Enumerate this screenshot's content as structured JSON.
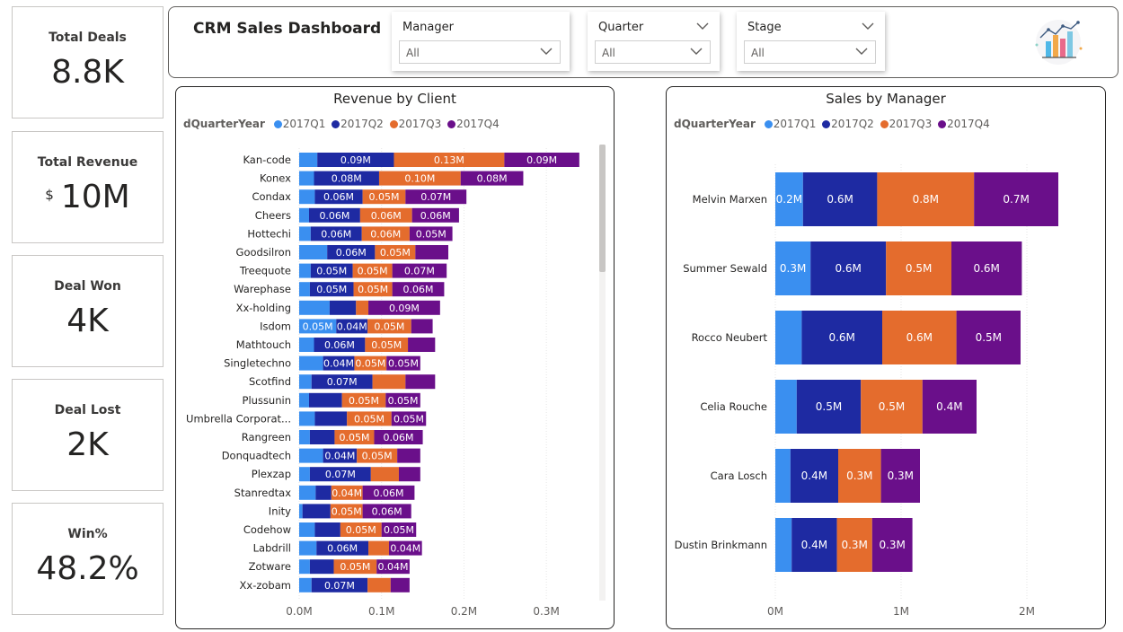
{
  "kpis": [
    {
      "label": "Total Deals",
      "value": "8.8K",
      "prefix": ""
    },
    {
      "label": "Total Revenue",
      "value": "10M",
      "prefix": "$"
    },
    {
      "label": "Deal Won",
      "value": "4K",
      "prefix": ""
    },
    {
      "label": "Deal Lost",
      "value": "2K",
      "prefix": ""
    },
    {
      "label": "Win%",
      "value": "48.2%",
      "prefix": ""
    }
  ],
  "header": {
    "title": "CRM Sales Dashboard",
    "logo_icon": "bar-line-chart-icon",
    "slicers": [
      {
        "label": "Manager",
        "value": "All",
        "header_chevron": false
      },
      {
        "label": "Quarter",
        "value": "All",
        "header_chevron": true
      },
      {
        "label": "Stage",
        "value": "All",
        "header_chevron": true
      }
    ]
  },
  "colors": {
    "2017Q1": "#3a8ff0",
    "2017Q2": "#1e2aa2",
    "2017Q3": "#e46c2d",
    "2017Q4": "#6a0f8a",
    "label_text": "#ffffff",
    "axis_text": "#605e5c"
  },
  "legend": {
    "title": "dQuarterYear",
    "items": [
      "2017Q1",
      "2017Q2",
      "2017Q3",
      "2017Q4"
    ]
  },
  "chart_data": [
    {
      "type": "bar",
      "orientation": "horizontal",
      "stacked": true,
      "title": "Revenue by Client",
      "legend_title": "dQuarterYear",
      "categories": [
        "Kan-code",
        "Konex",
        "Condax",
        "Cheers",
        "Hottechi",
        "Goodsilron",
        "Treequote",
        "Warephase",
        "Xx-holding",
        "Isdom",
        "Mathtouch",
        "Singletechno",
        "Scotfind",
        "Plussunin",
        "Umbrella Corporat...",
        "Rangreen",
        "Donquadtech",
        "Plexzap",
        "Stanredtax",
        "Inity",
        "Codehow",
        "Labdrill",
        "Zotware",
        "Xx-zobam"
      ],
      "series": [
        {
          "name": "2017Q1",
          "values": [
            0.022,
            0.018,
            0.019,
            0.012,
            0.014,
            0.034,
            0.014,
            0.013,
            0.037,
            0.045,
            0.018,
            0.029,
            0.015,
            0.012,
            0.019,
            0.013,
            0.029,
            0.013,
            0.02,
            0.004,
            0.019,
            0.021,
            0.013,
            0.015
          ]
        },
        {
          "name": "2017Q2",
          "values": [
            0.093,
            0.079,
            0.058,
            0.062,
            0.062,
            0.058,
            0.051,
            0.053,
            0.032,
            0.038,
            0.062,
            0.038,
            0.074,
            0.04,
            0.039,
            0.03,
            0.041,
            0.074,
            0.019,
            0.034,
            0.031,
            0.063,
            0.029,
            0.068
          ]
        },
        {
          "name": "2017Q3",
          "values": [
            0.134,
            0.099,
            0.052,
            0.063,
            0.058,
            0.049,
            0.048,
            0.047,
            0.015,
            0.053,
            0.052,
            0.039,
            0.04,
            0.053,
            0.054,
            0.048,
            0.049,
            0.034,
            0.038,
            0.039,
            0.05,
            0.025,
            0.052,
            0.028
          ]
        },
        {
          "name": "2017Q4",
          "values": [
            0.091,
            0.076,
            0.074,
            0.057,
            0.052,
            0.04,
            0.066,
            0.063,
            0.087,
            0.026,
            0.033,
            0.041,
            0.036,
            0.042,
            0.042,
            0.059,
            0.028,
            0.026,
            0.063,
            0.059,
            0.042,
            0.04,
            0.04,
            0.023
          ]
        }
      ],
      "labels": [
        [
          "",
          "0.09M",
          "0.13M",
          "0.09M"
        ],
        [
          "",
          "0.08M",
          "0.10M",
          "0.08M"
        ],
        [
          "",
          "0.06M",
          "0.05M",
          "0.07M"
        ],
        [
          "",
          "0.06M",
          "0.06M",
          "0.06M"
        ],
        [
          "",
          "0.06M",
          "0.06M",
          "0.05M"
        ],
        [
          "",
          "0.06M",
          "0.05M",
          ""
        ],
        [
          "",
          "0.05M",
          "0.05M",
          "0.07M"
        ],
        [
          "",
          "0.05M",
          "0.05M",
          "0.06M"
        ],
        [
          "",
          "",
          "",
          "0.09M"
        ],
        [
          "0.05M",
          "0.04M",
          "0.05M",
          ""
        ],
        [
          "",
          "0.06M",
          "0.05M",
          ""
        ],
        [
          "",
          "0.04M",
          "0.05M",
          "0.05M"
        ],
        [
          "",
          "0.07M",
          "",
          ""
        ],
        [
          "",
          "",
          "0.05M",
          "0.05M"
        ],
        [
          "",
          "",
          "0.05M",
          "0.05M"
        ],
        [
          "",
          "",
          "0.05M",
          "0.06M"
        ],
        [
          "",
          "0.04M",
          "0.05M",
          ""
        ],
        [
          "",
          "0.07M",
          "",
          ""
        ],
        [
          "",
          "",
          "0.04M",
          "0.06M"
        ],
        [
          "",
          "",
          "0.05M",
          "0.06M"
        ],
        [
          "",
          "",
          "0.05M",
          "0.05M"
        ],
        [
          "",
          "0.06M",
          "",
          "0.04M"
        ],
        [
          "",
          "",
          "0.05M",
          "0.04M"
        ],
        [
          "",
          "0.07M",
          "",
          ""
        ]
      ],
      "x_ticks": [
        "0.0M",
        "0.1M",
        "0.2M",
        "0.3M"
      ],
      "xlim": [
        0,
        0.35
      ],
      "grid": true,
      "legend_position": "top-left"
    },
    {
      "type": "bar",
      "orientation": "horizontal",
      "stacked": true,
      "title": "Sales by Manager",
      "legend_title": "dQuarterYear",
      "categories": [
        "Melvin Marxen",
        "Summer Sewald",
        "Rocco Neubert",
        "Celia Rouche",
        "Cara Losch",
        "Dustin Brinkmann"
      ],
      "series": [
        {
          "name": "2017Q1",
          "values": [
            0.22,
            0.28,
            0.21,
            0.17,
            0.12,
            0.13
          ]
        },
        {
          "name": "2017Q2",
          "values": [
            0.59,
            0.6,
            0.64,
            0.51,
            0.38,
            0.36
          ]
        },
        {
          "name": "2017Q3",
          "values": [
            0.77,
            0.52,
            0.59,
            0.49,
            0.34,
            0.28
          ]
        },
        {
          "name": "2017Q4",
          "values": [
            0.67,
            0.56,
            0.51,
            0.43,
            0.31,
            0.32
          ]
        }
      ],
      "labels": [
        [
          "0.2M",
          "0.6M",
          "0.8M",
          "0.7M"
        ],
        [
          "0.3M",
          "0.6M",
          "0.5M",
          "0.6M"
        ],
        [
          "",
          "0.6M",
          "0.6M",
          "0.5M"
        ],
        [
          "",
          "0.5M",
          "0.5M",
          "0.4M"
        ],
        [
          "",
          "0.4M",
          "0.3M",
          "0.3M"
        ],
        [
          "",
          "0.4M",
          "0.3M",
          "0.3M"
        ]
      ],
      "x_ticks": [
        "0M",
        "1M",
        "2M"
      ],
      "xlim": [
        0,
        2.6
      ],
      "grid": true,
      "legend_position": "top-left"
    }
  ]
}
